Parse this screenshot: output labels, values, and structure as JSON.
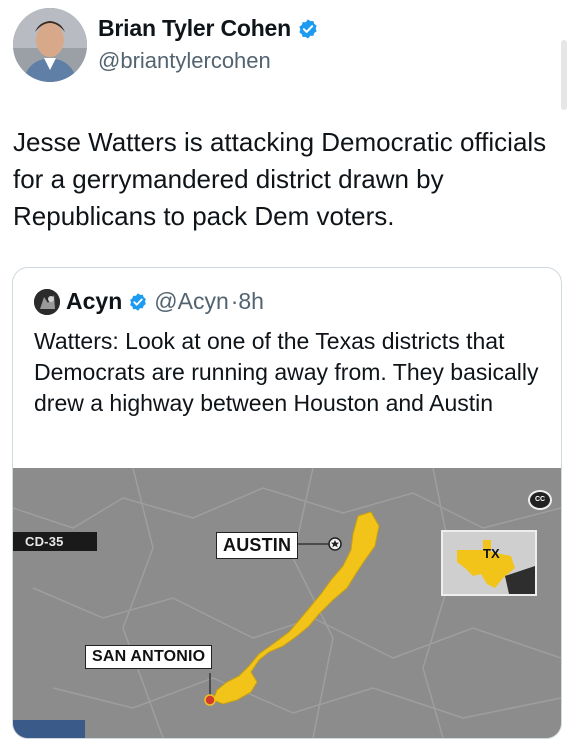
{
  "author": {
    "name": "Brian Tyler Cohen",
    "handle": "@briantylercohen",
    "verified": true
  },
  "tweet": {
    "text": "Jesse Watters is attacking Democratic officials for a gerrymandered district drawn by Republicans to pack Dem voters."
  },
  "quote": {
    "name": "Acyn",
    "handle": "@Acyn",
    "time": "·8h",
    "verified": true,
    "text": "Watters: Look at one of the Texas districts that Democrats are running away from. They basically drew a highway between Houston and Austin"
  },
  "media": {
    "district_label": "CD-35",
    "city_austin": "AUSTIN",
    "city_san_antonio": "SAN ANTONIO",
    "inset_state": "TX",
    "cc_label": "CC",
    "map_background": "#8c8c8c",
    "district_color": "#f2c318"
  },
  "colors": {
    "verified_blue": "#1d9bf0",
    "secondary_text": "#536471",
    "border": "#cfd9de"
  }
}
